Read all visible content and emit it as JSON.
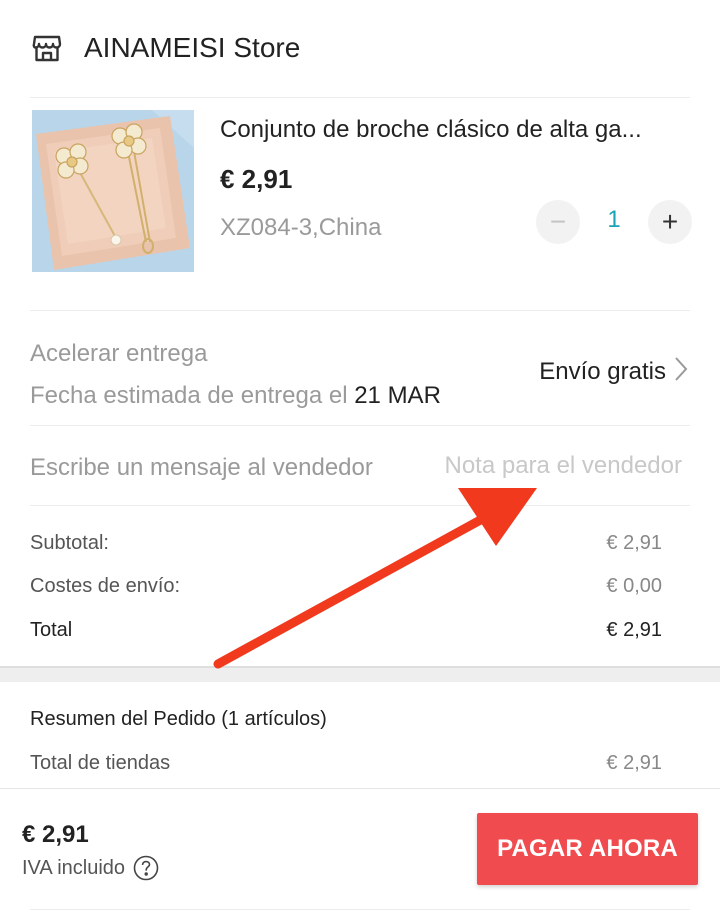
{
  "store": {
    "name": "AINAMEISI Store",
    "icon": "store-icon"
  },
  "product": {
    "title": "Conjunto de broche clásico de alta ga...",
    "price": "€ 2,91",
    "variant": "XZ084-3,China",
    "quantity": "1",
    "minus_glyph": "−",
    "plus_glyph": "+"
  },
  "delivery": {
    "label": "Acelerar entrega",
    "date_prefix": "Fecha estimada de entrega el",
    "date_value": "21 MAR",
    "shipping_option": "Envío gratis"
  },
  "message": {
    "label": "Escribe un mensaje al vendedor",
    "placeholder": "Nota para el vendedor"
  },
  "totals": {
    "subtotal_label": "Subtotal:",
    "subtotal_value": "€ 2,91",
    "shipping_label": "Costes de envío:",
    "shipping_value": "€ 0,00",
    "total_label": "Total",
    "total_value": "€ 2,91"
  },
  "summary": {
    "title": "Resumen del Pedido (1 artículos)",
    "stores_total_label": "Total de tiendas",
    "stores_total_value": "€ 2,91"
  },
  "footer": {
    "price": "€ 2,91",
    "vat_label": "IVA incluido",
    "pay_button": "PAGAR AHORA"
  },
  "colors": {
    "accent": "#f04c4f",
    "quantity": "#1aa4b5",
    "annotation_arrow": "#f0391d"
  }
}
